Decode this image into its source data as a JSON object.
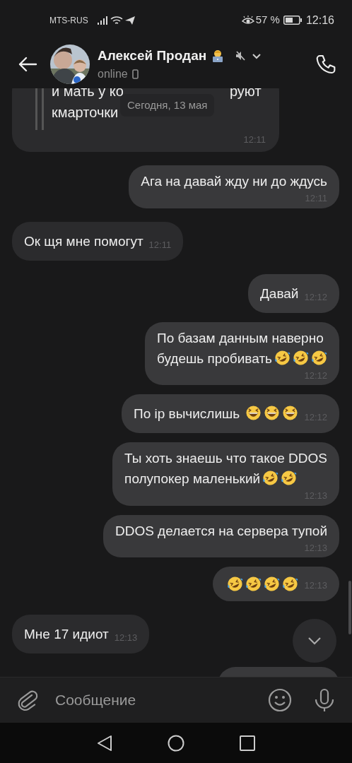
{
  "status_bar": {
    "carrier": "MTS-RUS",
    "battery": "57 %",
    "time": "12:16"
  },
  "header": {
    "name": "Алексей Продан",
    "muted": true,
    "subtitle": "online"
  },
  "date_pill": "Сегодня, 13 мая",
  "messages": [
    {
      "kind": "quote",
      "outgoing": false,
      "lines": [
        [
          "и мать у ко",
          "руют"
        ],
        [
          "кмарточки"
        ]
      ],
      "time": "12:11"
    },
    {
      "kind": "text",
      "outgoing": true,
      "lines": [
        "Ага на давай жду ни до ждусь"
      ],
      "time": "12:11",
      "time_below": true
    },
    {
      "kind": "text",
      "outgoing": false,
      "lines": [
        "Ок щя мне помогут"
      ],
      "time": "12:11",
      "time_below": false
    },
    {
      "kind": "text",
      "outgoing": true,
      "lines": [
        "Давай"
      ],
      "time": "12:12",
      "time_below": false
    },
    {
      "kind": "text",
      "outgoing": true,
      "lines": [
        "По базам данным наверно",
        "будешь пробивать"
      ],
      "emojis": [
        {
          "kind": "rofl"
        },
        {
          "kind": "rofl"
        },
        {
          "kind": "rofl"
        }
      ],
      "time": "12:12",
      "time_below": true
    },
    {
      "kind": "text",
      "outgoing": true,
      "lines": [
        "По ip вычислишь "
      ],
      "emojis": [
        {
          "kind": "laugh"
        },
        {
          "kind": "laugh"
        },
        {
          "kind": "laugh"
        }
      ],
      "time": "12:12",
      "time_below": false
    },
    {
      "kind": "text",
      "outgoing": true,
      "lines": [
        "Ты хоть знаешь что такое DDOS",
        "полупокер маленький"
      ],
      "emojis": [
        {
          "kind": "rofl"
        },
        {
          "kind": "rofl"
        }
      ],
      "time": "12:13",
      "time_below": true
    },
    {
      "kind": "text",
      "outgoing": true,
      "lines": [
        "DDOS делается на сервера тупой"
      ],
      "time": "12:13",
      "time_below": true
    },
    {
      "kind": "text",
      "outgoing": true,
      "emojis": [
        {
          "kind": "rofl"
        },
        {
          "kind": "rofl"
        },
        {
          "kind": "rofl"
        },
        {
          "kind": "rofl"
        }
      ],
      "time": "12:13",
      "time_below": false
    },
    {
      "kind": "text",
      "outgoing": false,
      "lines": [
        "Мне 17 идиот"
      ],
      "time": "12:13",
      "time_below": false
    },
    {
      "kind": "cut",
      "outgoing": true
    }
  ],
  "composer": {
    "placeholder": "Сообщение"
  }
}
